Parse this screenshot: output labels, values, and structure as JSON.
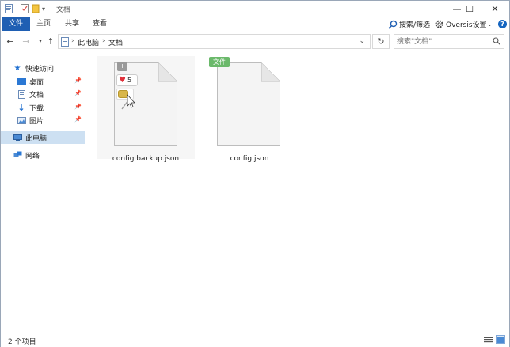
{
  "window": {
    "title": "文档",
    "controls": {
      "minimize": "—",
      "maximize": "☐",
      "close": "✕"
    }
  },
  "ribbon": {
    "tabs": [
      {
        "label": "文件"
      },
      {
        "label": "主页"
      },
      {
        "label": "共享"
      },
      {
        "label": "查看"
      }
    ],
    "search_filter_label": "搜索/筛选",
    "settings_label": "Oversis设置",
    "help": "?"
  },
  "address": {
    "breadcrumbs": [
      "此电脑",
      "文档"
    ],
    "search_placeholder": "搜索\"文档\""
  },
  "nav": {
    "quick_access": "快速访问",
    "items": [
      {
        "label": "桌面",
        "icon": "desktop-icon"
      },
      {
        "label": "文档",
        "icon": "documents-icon"
      },
      {
        "label": "下载",
        "icon": "download-icon"
      },
      {
        "label": "图片",
        "icon": "pictures-icon"
      }
    ],
    "this_pc": "此电脑",
    "network": "网络"
  },
  "files": [
    {
      "name": "config.backup.json",
      "overlay_plus": "+",
      "like_count": "5"
    },
    {
      "name": "config.json",
      "tag": "文件"
    }
  ],
  "status": {
    "item_count": "2 个项目"
  },
  "colors": {
    "file_tab": "#1f5fb3",
    "tag_green": "#6bb96b",
    "like_red": "#e0303a",
    "folder_yellow": "#d8b64a",
    "selected_nav": "#cde0f2",
    "help_blue": "#1565c0"
  }
}
